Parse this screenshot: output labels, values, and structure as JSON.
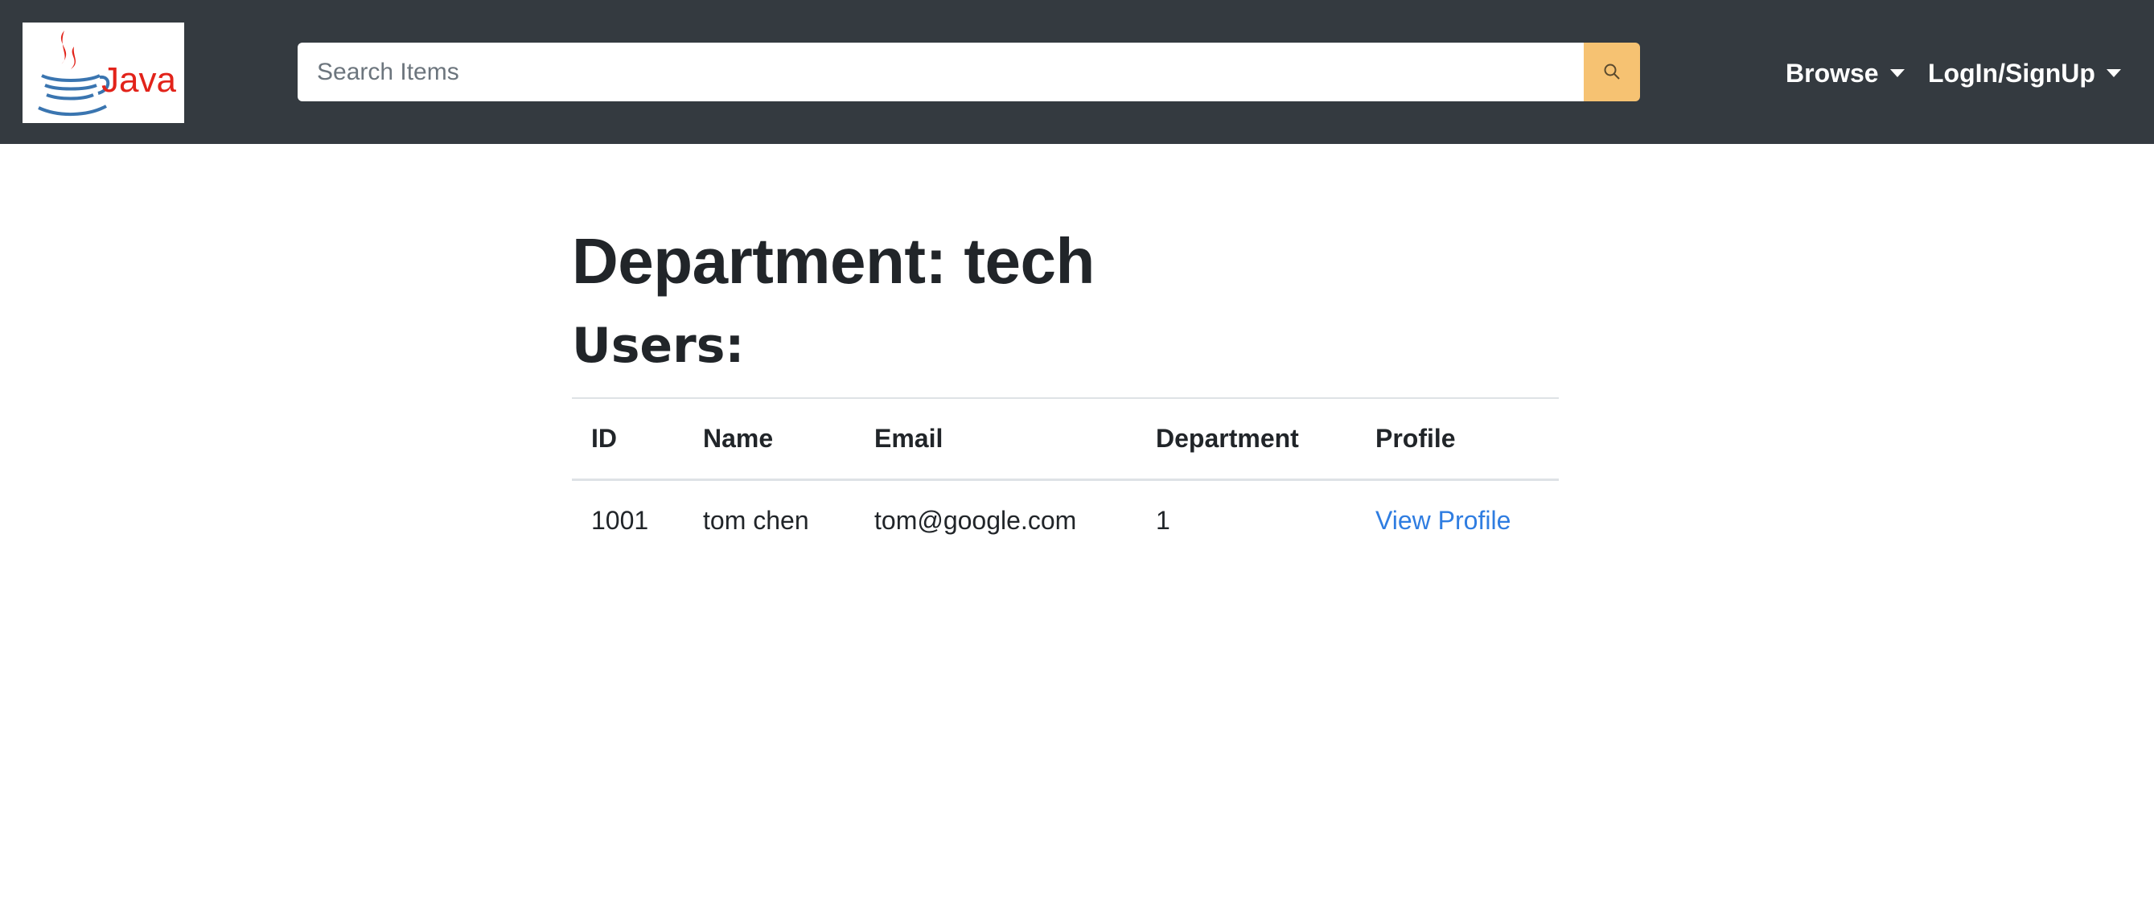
{
  "navbar": {
    "logo_text": "Java",
    "search": {
      "placeholder": "Search Items",
      "value": ""
    },
    "browse_label": "Browse",
    "login_label": "LogIn/SignUp",
    "icons": {
      "search": "search-icon",
      "browse": "caret-down-icon",
      "login": "caret-down-icon"
    }
  },
  "page": {
    "title": "Department: tech",
    "subtitle": "Users:"
  },
  "users_table": {
    "headers": [
      "ID",
      "Name",
      "Email",
      "Department",
      "Profile"
    ],
    "rows": [
      {
        "id": "1001",
        "name": "tom chen",
        "email": "tom@google.com",
        "department": "1",
        "profile_link": "View Profile"
      }
    ]
  },
  "colors": {
    "navbar_bg": "#343a40",
    "search_button": "#f6c272",
    "link": "#2f7de1",
    "logo_red": "#e2231a",
    "logo_blue": "#3a75b0"
  }
}
